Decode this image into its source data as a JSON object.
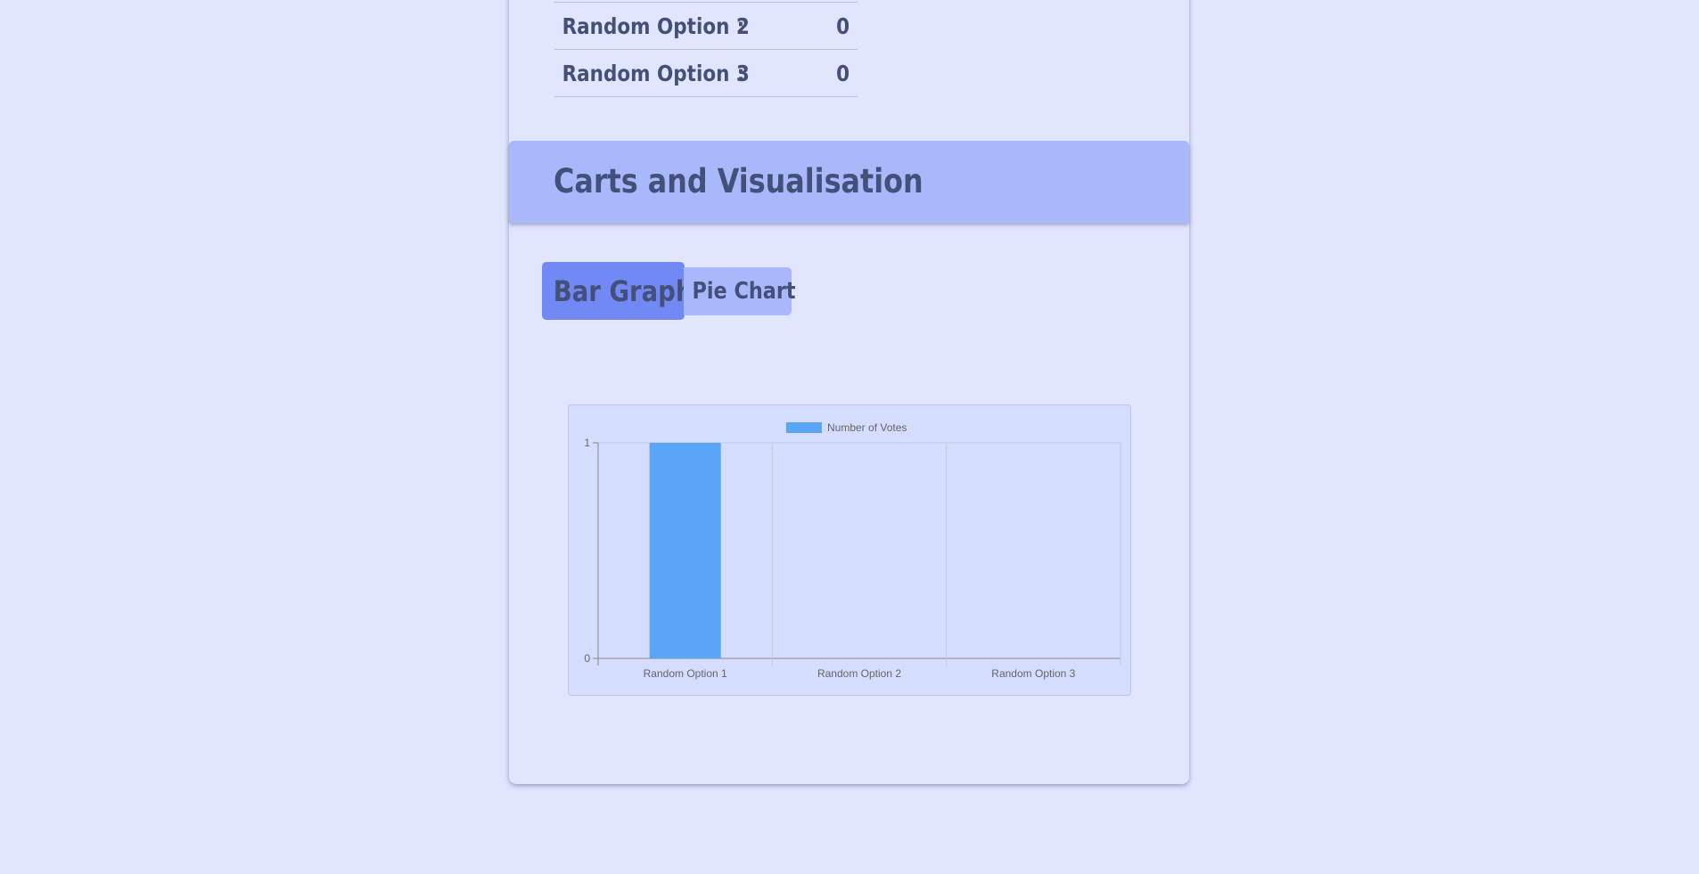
{
  "results": [
    {
      "option": "Random Option 2",
      "separator": ":",
      "count": "0"
    },
    {
      "option": "Random Option 3",
      "separator": ":",
      "count": "0"
    }
  ],
  "section": {
    "title": "Carts and Visualisation"
  },
  "tabs": {
    "bar_label": "Bar Graph",
    "pie_label": "Pie Chart",
    "active": "Bar Graph"
  },
  "colors": {
    "background": "#e1e6fe",
    "header": "#a9b7fb",
    "active_tab": "#7288f4",
    "text": "#43507a",
    "bar": "#5aa5f6"
  },
  "chart_data": {
    "type": "bar",
    "categories": [
      "Random Option 1",
      "Random Option 2",
      "Random Option 3"
    ],
    "series": [
      {
        "name": "Number of Votes",
        "values": [
          1,
          0,
          0
        ],
        "color": "#5aa5f6"
      }
    ],
    "ylim": [
      0,
      1
    ],
    "yticks": [
      0,
      1
    ],
    "legend": "top",
    "grid": true
  }
}
